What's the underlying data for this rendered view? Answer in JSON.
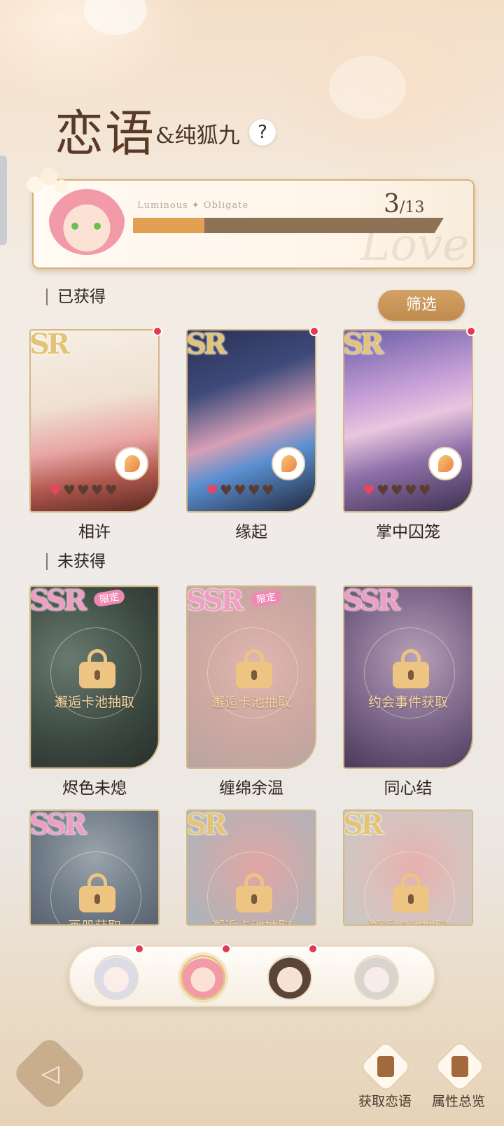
{
  "header": {
    "title": "恋语",
    "character": "&纯狐九",
    "help_label": "?"
  },
  "progress": {
    "watermark": "Love",
    "subtitle": "Luminous ✦ Obligate",
    "current": "3",
    "total": "/13",
    "value": 3,
    "max": 13
  },
  "obtained": {
    "title": "已获得",
    "filter_label": "筛选",
    "cards": [
      {
        "name": "相许",
        "rarity": "SR",
        "hearts_on": 1,
        "hearts_total": 5
      },
      {
        "name": "缘起",
        "rarity": "SR",
        "hearts_on": 1,
        "hearts_total": 5
      },
      {
        "name": "掌中囚笼",
        "rarity": "SR",
        "hearts_on": 1,
        "hearts_total": 5
      }
    ]
  },
  "unobtained": {
    "title": "未获得",
    "limited_label": "限定",
    "cards": [
      {
        "name": "烬色未熄",
        "rarity": "SSR",
        "limited": true,
        "unlock": "邂逅卡池抽取"
      },
      {
        "name": "缠绵余温",
        "rarity": "SSR",
        "limited": true,
        "unlock": "邂逅卡池抽取"
      },
      {
        "name": "同心结",
        "rarity": "SSR",
        "limited": false,
        "unlock": "约会事件获取"
      },
      {
        "name": "",
        "rarity": "SSR",
        "limited": false,
        "unlock": "画册获取"
      },
      {
        "name": "",
        "rarity": "SR",
        "limited": false,
        "unlock": "邂逅卡池抽取"
      },
      {
        "name": "",
        "rarity": "SR",
        "limited": false,
        "unlock": "邂逅卡池抽取"
      }
    ]
  },
  "characters": [
    {
      "icon": "white-hair-character-avatar",
      "active": false,
      "notify": true
    },
    {
      "icon": "pink-hair-character-avatar",
      "active": true,
      "notify": true
    },
    {
      "icon": "brown-hair-character-avatar",
      "active": false,
      "notify": true
    },
    {
      "icon": "silver-hair-character-avatar",
      "active": false,
      "notify": false
    }
  ],
  "footer": {
    "back_icon": "back-arrow-icon",
    "get_label": "获取恋语",
    "overview_label": "属性总览"
  },
  "colors": {
    "accent": "#c08a4e",
    "progress_fill": "#e1a052",
    "heart_on": "#e8465e",
    "notify": "#e8384e"
  }
}
